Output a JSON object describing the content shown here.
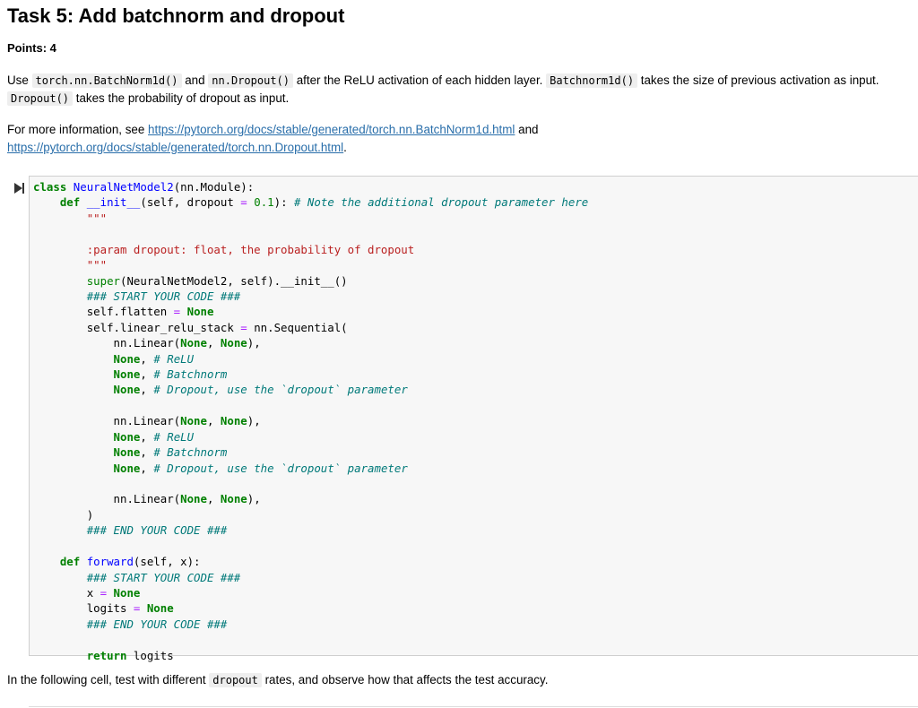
{
  "heading": "Task 5: Add batchnorm and dropout",
  "points": "Points: 4",
  "para1": {
    "t1": "Use ",
    "c1": "torch.nn.BatchNorm1d()",
    "t2": " and ",
    "c2": "nn.Dropout()",
    "t3": " after the ReLU activation of each hidden layer. ",
    "c3": "Batchnorm1d()",
    "t4": " takes the size of previous activation as input. ",
    "c4": "Dropout()",
    "t5": " takes the probability of dropout as input."
  },
  "para2": {
    "t1": "For more information, see ",
    "link1": "https://pytorch.org/docs/stable/generated/torch.nn.BatchNorm1d.html",
    "t2": " and ",
    "link2": "https://pytorch.org/docs/stable/generated/torch.nn.Dropout.html",
    "t3": "."
  },
  "code": {
    "class_kw": "class",
    "class_name": "NeuralNetModel2",
    "class_base": "(nn.Module):",
    "def_kw": "def",
    "init_name": "__init__",
    "init_sig1": "(self, dropout ",
    "eq": "=",
    "init_default": "0.1",
    "init_sig2": "): ",
    "init_comment": "# Note the additional dropout parameter here",
    "docstring_quotes": "\"\"\"",
    "docstring_body": ":param dropout: float, the probability of dropout",
    "super_name": "super",
    "super_rest": "(NeuralNetModel2, self).__init__()",
    "start_comment": "### START YOUR CODE ###",
    "end_comment": "### END YOUR CODE ###",
    "self_flatten": "self.flatten ",
    "none": "None",
    "self_stack": "self.linear_relu_stack ",
    "seq": " nn.Sequential(",
    "linear_open": "nn.Linear(",
    "comma_space": ", ",
    "close_paren_comma": "),",
    "comma": ",",
    "relu_comment": "# ReLU",
    "batchnorm_comment": "# Batchnorm",
    "dropout_comment": "# Dropout, use the `dropout` parameter",
    "close_paren": ")",
    "forward_name": "forward",
    "forward_sig": "(self, x):",
    "x_assign": "x ",
    "logits_assign": "logits ",
    "return_kw": "return",
    "return_val": " logits"
  },
  "para3": {
    "t1": "In the following cell, test with different ",
    "c1": "dropout",
    "t2": " rates, and observe how that affects the test accuracy."
  }
}
